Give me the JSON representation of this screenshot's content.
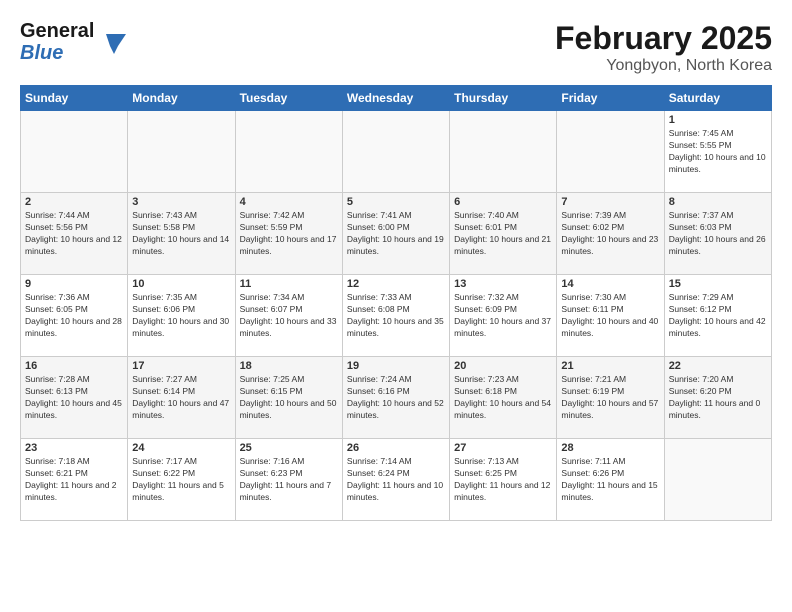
{
  "header": {
    "logo_general": "General",
    "logo_blue": "Blue",
    "month_year": "February 2025",
    "location": "Yongbyon, North Korea"
  },
  "days_of_week": [
    "Sunday",
    "Monday",
    "Tuesday",
    "Wednesday",
    "Thursday",
    "Friday",
    "Saturday"
  ],
  "weeks": [
    {
      "days": [
        {
          "num": "",
          "info": ""
        },
        {
          "num": "",
          "info": ""
        },
        {
          "num": "",
          "info": ""
        },
        {
          "num": "",
          "info": ""
        },
        {
          "num": "",
          "info": ""
        },
        {
          "num": "",
          "info": ""
        },
        {
          "num": "1",
          "info": "Sunrise: 7:45 AM\nSunset: 5:55 PM\nDaylight: 10 hours and 10 minutes."
        }
      ]
    },
    {
      "days": [
        {
          "num": "2",
          "info": "Sunrise: 7:44 AM\nSunset: 5:56 PM\nDaylight: 10 hours and 12 minutes."
        },
        {
          "num": "3",
          "info": "Sunrise: 7:43 AM\nSunset: 5:58 PM\nDaylight: 10 hours and 14 minutes."
        },
        {
          "num": "4",
          "info": "Sunrise: 7:42 AM\nSunset: 5:59 PM\nDaylight: 10 hours and 17 minutes."
        },
        {
          "num": "5",
          "info": "Sunrise: 7:41 AM\nSunset: 6:00 PM\nDaylight: 10 hours and 19 minutes."
        },
        {
          "num": "6",
          "info": "Sunrise: 7:40 AM\nSunset: 6:01 PM\nDaylight: 10 hours and 21 minutes."
        },
        {
          "num": "7",
          "info": "Sunrise: 7:39 AM\nSunset: 6:02 PM\nDaylight: 10 hours and 23 minutes."
        },
        {
          "num": "8",
          "info": "Sunrise: 7:37 AM\nSunset: 6:03 PM\nDaylight: 10 hours and 26 minutes."
        }
      ]
    },
    {
      "days": [
        {
          "num": "9",
          "info": "Sunrise: 7:36 AM\nSunset: 6:05 PM\nDaylight: 10 hours and 28 minutes."
        },
        {
          "num": "10",
          "info": "Sunrise: 7:35 AM\nSunset: 6:06 PM\nDaylight: 10 hours and 30 minutes."
        },
        {
          "num": "11",
          "info": "Sunrise: 7:34 AM\nSunset: 6:07 PM\nDaylight: 10 hours and 33 minutes."
        },
        {
          "num": "12",
          "info": "Sunrise: 7:33 AM\nSunset: 6:08 PM\nDaylight: 10 hours and 35 minutes."
        },
        {
          "num": "13",
          "info": "Sunrise: 7:32 AM\nSunset: 6:09 PM\nDaylight: 10 hours and 37 minutes."
        },
        {
          "num": "14",
          "info": "Sunrise: 7:30 AM\nSunset: 6:11 PM\nDaylight: 10 hours and 40 minutes."
        },
        {
          "num": "15",
          "info": "Sunrise: 7:29 AM\nSunset: 6:12 PM\nDaylight: 10 hours and 42 minutes."
        }
      ]
    },
    {
      "days": [
        {
          "num": "16",
          "info": "Sunrise: 7:28 AM\nSunset: 6:13 PM\nDaylight: 10 hours and 45 minutes."
        },
        {
          "num": "17",
          "info": "Sunrise: 7:27 AM\nSunset: 6:14 PM\nDaylight: 10 hours and 47 minutes."
        },
        {
          "num": "18",
          "info": "Sunrise: 7:25 AM\nSunset: 6:15 PM\nDaylight: 10 hours and 50 minutes."
        },
        {
          "num": "19",
          "info": "Sunrise: 7:24 AM\nSunset: 6:16 PM\nDaylight: 10 hours and 52 minutes."
        },
        {
          "num": "20",
          "info": "Sunrise: 7:23 AM\nSunset: 6:18 PM\nDaylight: 10 hours and 54 minutes."
        },
        {
          "num": "21",
          "info": "Sunrise: 7:21 AM\nSunset: 6:19 PM\nDaylight: 10 hours and 57 minutes."
        },
        {
          "num": "22",
          "info": "Sunrise: 7:20 AM\nSunset: 6:20 PM\nDaylight: 11 hours and 0 minutes."
        }
      ]
    },
    {
      "days": [
        {
          "num": "23",
          "info": "Sunrise: 7:18 AM\nSunset: 6:21 PM\nDaylight: 11 hours and 2 minutes."
        },
        {
          "num": "24",
          "info": "Sunrise: 7:17 AM\nSunset: 6:22 PM\nDaylight: 11 hours and 5 minutes."
        },
        {
          "num": "25",
          "info": "Sunrise: 7:16 AM\nSunset: 6:23 PM\nDaylight: 11 hours and 7 minutes."
        },
        {
          "num": "26",
          "info": "Sunrise: 7:14 AM\nSunset: 6:24 PM\nDaylight: 11 hours and 10 minutes."
        },
        {
          "num": "27",
          "info": "Sunrise: 7:13 AM\nSunset: 6:25 PM\nDaylight: 11 hours and 12 minutes."
        },
        {
          "num": "28",
          "info": "Sunrise: 7:11 AM\nSunset: 6:26 PM\nDaylight: 11 hours and 15 minutes."
        },
        {
          "num": "",
          "info": ""
        }
      ]
    }
  ]
}
